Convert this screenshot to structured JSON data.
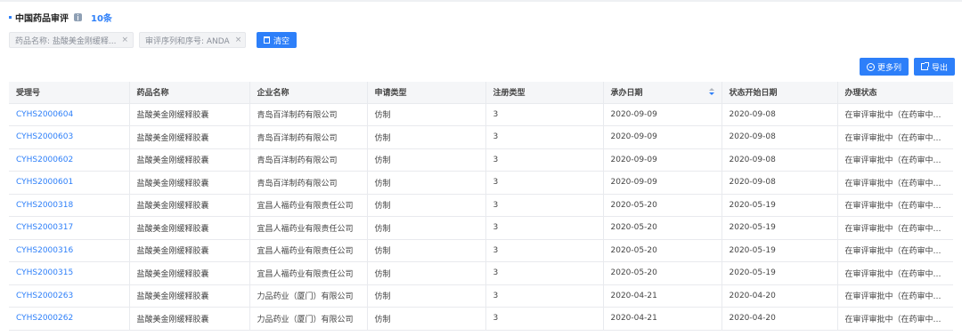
{
  "header": {
    "title": "中国药品审评",
    "count": "10条"
  },
  "filters": [
    {
      "label": "药品名称: 盐酸美金刚缓释...",
      "close": "×"
    },
    {
      "label": "审评序列和序号: ANDA",
      "close": "×"
    }
  ],
  "clear_label": "清空",
  "actions": {
    "more_columns": "更多列",
    "export": "导出"
  },
  "table": {
    "columns": [
      "受理号",
      "药品名称",
      "企业名称",
      "申请类型",
      "注册类型",
      "承办日期",
      "状态开始日期",
      "办理状态"
    ],
    "rows": [
      [
        "CYHS2000604",
        "盐酸美金刚缓释胶囊",
        "青岛百洋制药有限公司",
        "仿制",
        "3",
        "2020-09-09",
        "2020-09-08",
        "在审评审批中（在药审中心）"
      ],
      [
        "CYHS2000603",
        "盐酸美金刚缓释胶囊",
        "青岛百洋制药有限公司",
        "仿制",
        "3",
        "2020-09-09",
        "2020-09-08",
        "在审评审批中（在药审中心）"
      ],
      [
        "CYHS2000602",
        "盐酸美金刚缓释胶囊",
        "青岛百洋制药有限公司",
        "仿制",
        "3",
        "2020-09-09",
        "2020-09-08",
        "在审评审批中（在药审中心）"
      ],
      [
        "CYHS2000601",
        "盐酸美金刚缓释胶囊",
        "青岛百洋制药有限公司",
        "仿制",
        "3",
        "2020-09-09",
        "2020-09-08",
        "在审评审批中（在药审中心）"
      ],
      [
        "CYHS2000318",
        "盐酸美金刚缓释胶囊",
        "宜昌人福药业有限责任公司",
        "仿制",
        "3",
        "2020-05-20",
        "2020-05-19",
        "在审评审批中（在药审中心）"
      ],
      [
        "CYHS2000317",
        "盐酸美金刚缓释胶囊",
        "宜昌人福药业有限责任公司",
        "仿制",
        "3",
        "2020-05-20",
        "2020-05-19",
        "在审评审批中（在药审中心）"
      ],
      [
        "CYHS2000316",
        "盐酸美金刚缓释胶囊",
        "宜昌人福药业有限责任公司",
        "仿制",
        "3",
        "2020-05-20",
        "2020-05-19",
        "在审评审批中（在药审中心）"
      ],
      [
        "CYHS2000315",
        "盐酸美金刚缓释胶囊",
        "宜昌人福药业有限责任公司",
        "仿制",
        "3",
        "2020-05-20",
        "2020-05-19",
        "在审评审批中（在药审中心）"
      ],
      [
        "CYHS2000263",
        "盐酸美金刚缓释胶囊",
        "力品药业（厦门）有限公司",
        "仿制",
        "3",
        "2020-04-21",
        "2020-04-20",
        "在审评审批中（在药审中心）"
      ],
      [
        "CYHS2000262",
        "盐酸美金刚缓释胶囊",
        "力品药业（厦门）有限公司",
        "仿制",
        "3",
        "2020-04-21",
        "2020-04-20",
        "在审评审批中（在药审中心）"
      ]
    ]
  },
  "colors": {
    "accent": "#2d7ff9",
    "header_bg": "#f5f6f8",
    "chip_bg": "#f2f3f5"
  }
}
